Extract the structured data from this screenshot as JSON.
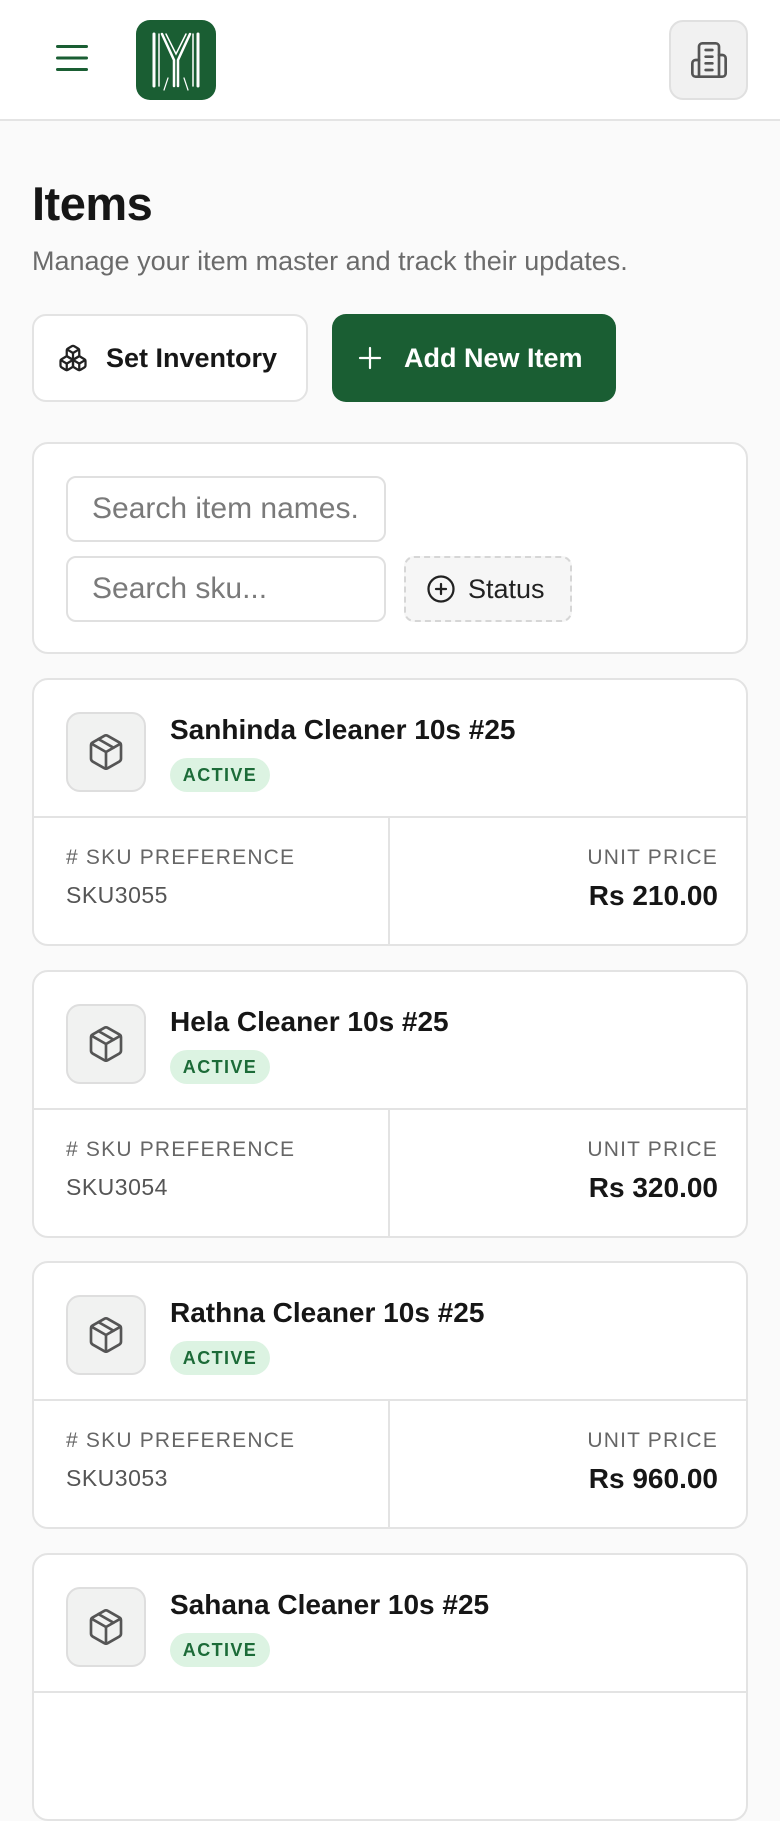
{
  "header": {
    "menu_icon": "hamburger-menu-icon",
    "logo_icon": "brand-logo",
    "org_icon": "building-icon"
  },
  "page": {
    "title": "Items",
    "subtitle": "Manage your item master and track their updates."
  },
  "actions": {
    "set_inventory_label": "Set Inventory",
    "set_inventory_icon": "boxes-icon",
    "add_item_label": "Add New Item",
    "add_item_icon": "plus-icon"
  },
  "filters": {
    "name_placeholder": "Search item names...",
    "sku_placeholder": "Search sku...",
    "status_label": "Status",
    "status_icon": "plus-circle-icon"
  },
  "labels": {
    "sku_preference": "# SKU PREFERENCE",
    "unit_price": "UNIT PRICE"
  },
  "items": [
    {
      "name": "Sanhinda Cleaner 10s #25",
      "status": "ACTIVE",
      "sku": "SKU3055",
      "price": "Rs 210.00"
    },
    {
      "name": "Hela Cleaner 10s #25",
      "status": "ACTIVE",
      "sku": "SKU3054",
      "price": "Rs 320.00"
    },
    {
      "name": "Rathna Cleaner 10s #25",
      "status": "ACTIVE",
      "sku": "SKU3053",
      "price": "Rs 960.00"
    },
    {
      "name": "Sahana Cleaner 10s #25",
      "status": "ACTIVE"
    }
  ],
  "colors": {
    "brand": "#1a5e33",
    "badge_bg": "#dcf3e2",
    "badge_text": "#1c6b38"
  }
}
